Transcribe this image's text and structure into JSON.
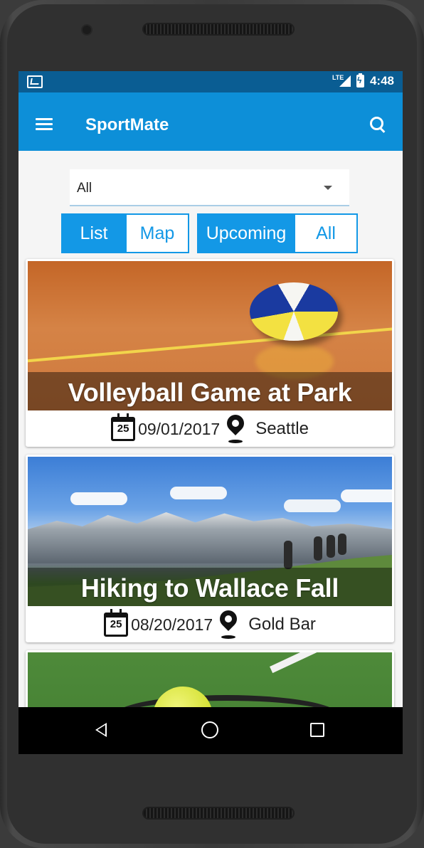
{
  "status_bar": {
    "network": "LTE",
    "time": "4:48"
  },
  "app_bar": {
    "title": "SportMate",
    "menu_icon": "hamburger-menu-icon",
    "search_icon": "search-icon"
  },
  "filter": {
    "selected": "All"
  },
  "view_toggle": {
    "options": [
      "List",
      "Map"
    ],
    "selected": "List"
  },
  "time_toggle": {
    "options": [
      "Upcoming",
      "All"
    ],
    "selected": "Upcoming"
  },
  "events": [
    {
      "title": "Volleyball Game at Park",
      "date": "09/01/2017",
      "location": "Seattle",
      "calendar_day": "25"
    },
    {
      "title": "Hiking to Wallace Fall",
      "date": "08/20/2017",
      "location": "Gold Bar",
      "calendar_day": "25"
    },
    {
      "title": "",
      "date": "",
      "location": "",
      "calendar_day": ""
    }
  ],
  "colors": {
    "primary": "#0d8fd8",
    "status_bar": "#0a5d93",
    "accent": "#1398e6"
  }
}
